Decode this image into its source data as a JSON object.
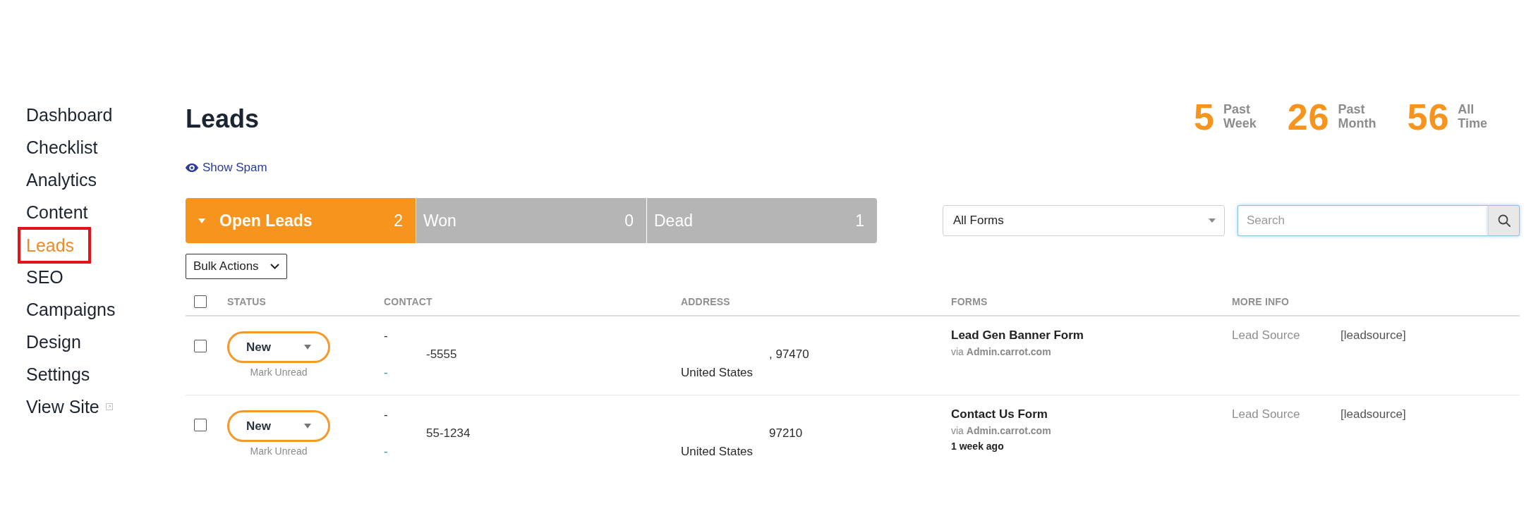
{
  "sidebar": {
    "items": [
      {
        "label": "Dashboard",
        "kind": "link",
        "selected": false,
        "highlighted": false
      },
      {
        "label": "Checklist",
        "kind": "link",
        "selected": false,
        "highlighted": false
      },
      {
        "label": "Analytics",
        "kind": "link",
        "selected": false,
        "highlighted": false
      },
      {
        "label": "Content",
        "kind": "link",
        "selected": false,
        "highlighted": false
      },
      {
        "label": "Leads",
        "kind": "link",
        "selected": true,
        "highlighted": true
      },
      {
        "label": "SEO",
        "kind": "link",
        "selected": false,
        "highlighted": false
      },
      {
        "label": "Campaigns",
        "kind": "link",
        "selected": false,
        "highlighted": false
      },
      {
        "label": "Design",
        "kind": "link",
        "selected": false,
        "highlighted": false
      },
      {
        "label": "Settings",
        "kind": "link",
        "selected": false,
        "highlighted": false
      },
      {
        "label": "View Site",
        "kind": "external",
        "selected": false,
        "highlighted": false
      }
    ]
  },
  "header": {
    "title": "Leads",
    "show_spam": "Show Spam"
  },
  "stats": [
    {
      "value": "5",
      "label": "Past Week"
    },
    {
      "value": "26",
      "label": "Past Month"
    },
    {
      "value": "56",
      "label": "All Time"
    }
  ],
  "status_tabs": [
    {
      "label": "Open Leads",
      "count": "2",
      "selected": true
    },
    {
      "label": "Won",
      "count": "0",
      "selected": false
    },
    {
      "label": "Dead",
      "count": "1",
      "selected": false
    }
  ],
  "bulk_actions": {
    "label": "Bulk Actions"
  },
  "form_filter": {
    "value": "All Forms"
  },
  "search": {
    "placeholder": "Search"
  },
  "table": {
    "select_all": {
      "checked": false
    },
    "columns": [
      "STATUS",
      "CONTACT",
      "ADDRESS",
      "FORMS",
      "MORE INFO"
    ],
    "rows": [
      {
        "checked": false,
        "status": "New",
        "status_action": "Mark Unread",
        "contact": {
          "name": "-",
          "phone": "-5555",
          "email": "-"
        },
        "address": {
          "locality": ", 97470",
          "country": "United States"
        },
        "form": {
          "name": "Lead Gen Banner Form",
          "via": "via **Admin.carrot.com**"
        },
        "more_info": {
          "label": "Lead Source",
          "value": "[leadsource]"
        }
      },
      {
        "checked": false,
        "status": "New",
        "status_action": "Mark Unread",
        "contact": {
          "name": "-",
          "phone": "55-1234",
          "email": "-"
        },
        "address": {
          "locality": "97210",
          "country": "United States"
        },
        "form": {
          "name": "Contact Us Form",
          "via": "via **Admin.carrot.com**",
          "age": "1 week ago"
        },
        "more_info": {
          "label": "Lead Source",
          "value": "[leadsource]"
        }
      }
    ]
  }
}
